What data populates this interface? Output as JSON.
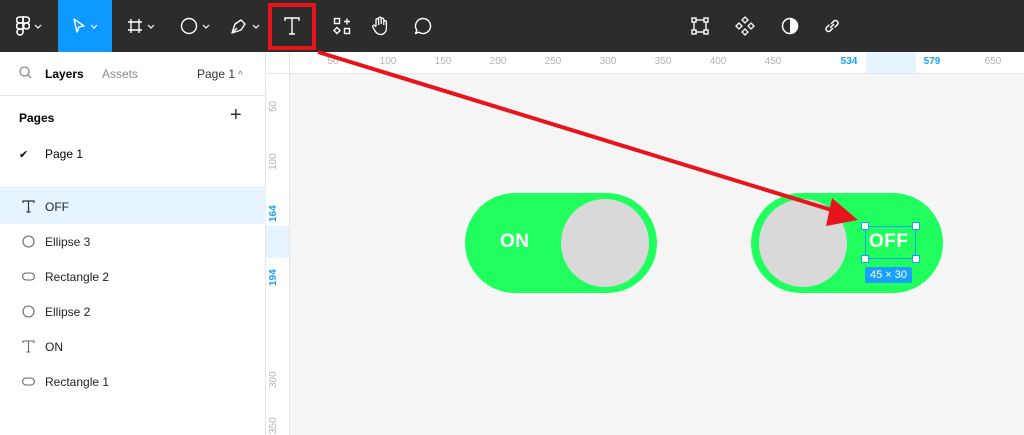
{
  "toolbar": {
    "tools": [
      {
        "name": "main-menu",
        "icon": "figma-logo-icon"
      },
      {
        "name": "move-tool",
        "icon": "pointer-icon",
        "active": true
      },
      {
        "name": "frame-tool",
        "icon": "frame-icon"
      },
      {
        "name": "shape-tool",
        "icon": "ellipse-icon"
      },
      {
        "name": "pen-tool",
        "icon": "pen-icon"
      },
      {
        "name": "text-tool",
        "icon": "text-icon",
        "highlighted": true
      },
      {
        "name": "resources-tool",
        "icon": "resources-icon"
      },
      {
        "name": "hand-tool",
        "icon": "hand-icon"
      },
      {
        "name": "comment-tool",
        "icon": "comment-icon"
      }
    ],
    "right_tools": [
      "edit-object-icon",
      "component-icon",
      "mask-icon",
      "link-icon"
    ],
    "accent": "#0d99ff"
  },
  "panel": {
    "tabs": {
      "layers": "Layers",
      "assets": "Assets",
      "page": "Page 1"
    },
    "pages_title": "Pages",
    "pages": [
      {
        "label": "Page 1",
        "current": true
      }
    ],
    "layers": [
      {
        "label": "OFF",
        "icon": "text-icon",
        "selected": true
      },
      {
        "label": "Ellipse 3",
        "icon": "ellipse-icon"
      },
      {
        "label": "Rectangle 2",
        "icon": "rectangle-icon"
      },
      {
        "label": "Ellipse 2",
        "icon": "ellipse-icon"
      },
      {
        "label": "ON",
        "icon": "text-icon"
      },
      {
        "label": "Rectangle 1",
        "icon": "rectangle-icon"
      }
    ]
  },
  "rulers": {
    "top": [
      "50",
      "100",
      "150",
      "200",
      "250",
      "300",
      "350",
      "400",
      "450",
      "534",
      "579",
      "650"
    ],
    "top_highlight": [
      "534",
      "579"
    ],
    "left": [
      "50",
      "100",
      "164",
      "194",
      "300",
      "350"
    ],
    "left_highlight": [
      "164",
      "194"
    ]
  },
  "canvas": {
    "toggle_on_label": "ON",
    "toggle_off_label": "OFF",
    "selection_size": "45 × 30",
    "toggle_color": "#21ff5f",
    "knob_color": "#d9d9d9",
    "selection_color": "#18a0fb",
    "annotation_color": "#e8141c"
  }
}
